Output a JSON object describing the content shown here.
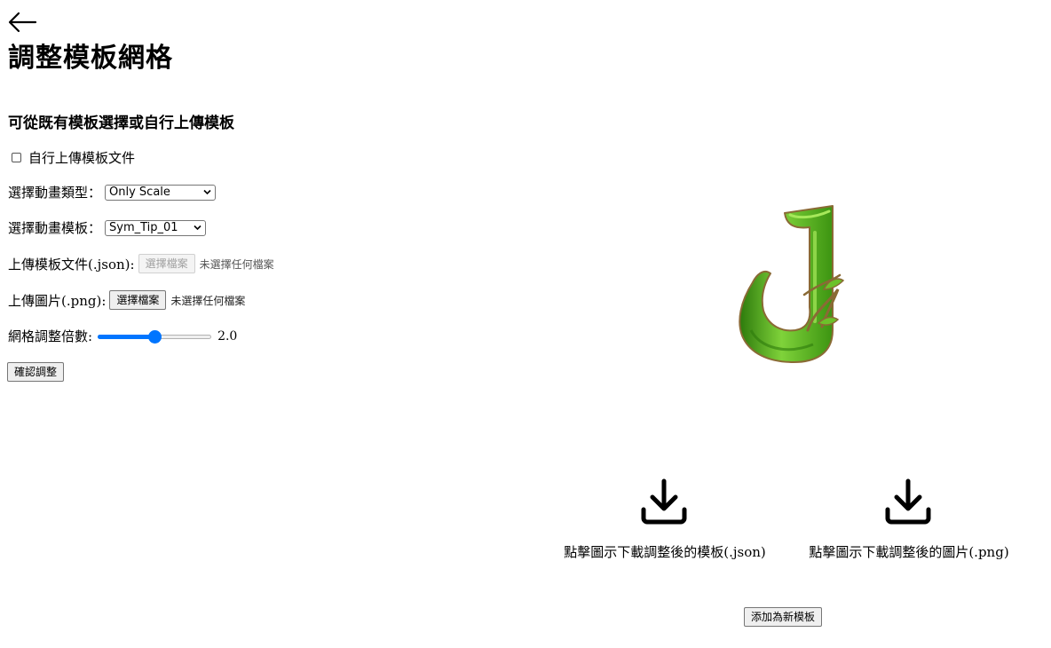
{
  "header": {
    "back_icon": "arrow-left-icon",
    "title": "調整模板網格"
  },
  "form": {
    "section_title": "可從既有模板選擇或自行上傳模板",
    "upload_toggle": {
      "label": "自行上傳模板文件",
      "checked": false
    },
    "animation_type": {
      "label": "選擇動畫類型：",
      "selected": "Only Scale"
    },
    "animation_template": {
      "label": "選擇動畫模板：",
      "selected": "Sym_Tip_01"
    },
    "template_file": {
      "label": "上傳模板文件(.json):",
      "button": "選擇檔案",
      "status": "未選擇任何檔案",
      "disabled": true
    },
    "image_file": {
      "label": "上傳圖片(.png):",
      "button": "選擇檔案",
      "status": "未選擇任何檔案"
    },
    "grid_scale": {
      "label": "網格調整倍數:",
      "value": "2.0",
      "fraction": 0.5
    },
    "confirm_button": "確認調整"
  },
  "preview": {
    "symbol": "J",
    "colors": {
      "main": "#52b81a",
      "highlight": "#a6e85a",
      "shadow": "#2d7a0c",
      "outline": "#8a6a35"
    }
  },
  "downloads": {
    "template": {
      "icon": "download-icon",
      "caption": "點擊圖示下載調整後的模板(.json)"
    },
    "image": {
      "icon": "download-icon",
      "caption": "點擊圖示下載調整後的圖片(.png)"
    }
  },
  "add_template_button": "添加為新模板",
  "colors": {
    "accent": "#0075ff",
    "button_bg": "#efefef",
    "button_border": "#767676"
  }
}
